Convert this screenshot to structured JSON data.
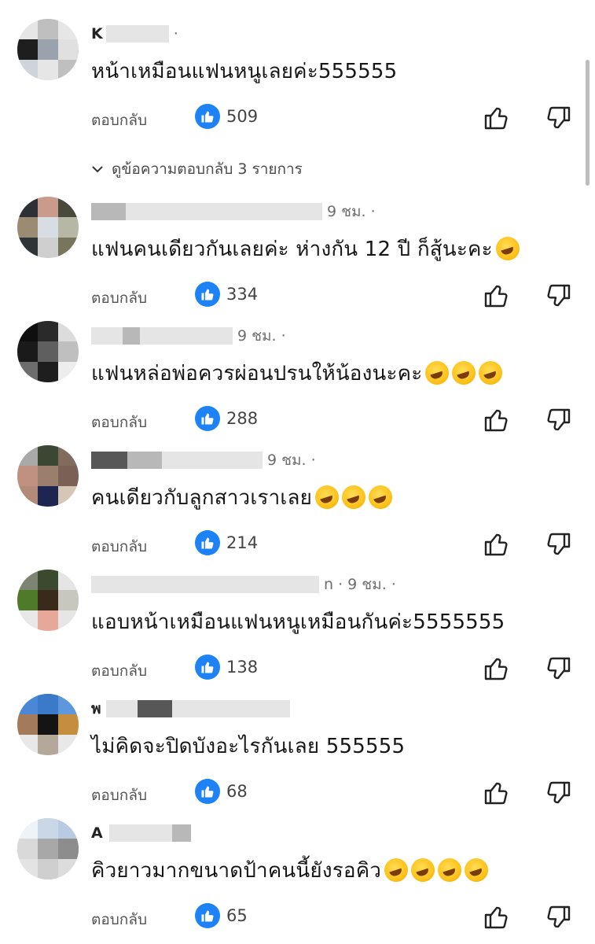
{
  "reply_label": "ตอบกลับ",
  "view_replies_label": "ดูข้อความตอบกลับ 3 รายการ",
  "colors": {
    "like_badge": "#1d82f5",
    "text": "#161616",
    "muted": "#6e6e6e"
  },
  "comments": [
    {
      "name": "K",
      "meta": "·",
      "text": "หน้าเหมือนแฟนหนูเลยค่ะ555555",
      "emoji_count": 0,
      "likes": "509",
      "avatar": [
        "#e6e6e6",
        "#bfbfbf",
        "#e6e6e6",
        "#1e1e1e",
        "#9aa2ad",
        "#e0e0e0",
        "#cfd4da",
        "#e6e6e6",
        "#bfbfbf"
      ]
    },
    {
      "name": "",
      "meta": "9 ชม. ·",
      "text": "แฟนคนเดียวกันเลยค่ะ ห่างกัน 12 ปี ก็สู้นะคะ",
      "emoji_count": 1,
      "likes": "334",
      "avatar": [
        "#2d3136",
        "#c99b8c",
        "#4a4a3c",
        "#9b8b72",
        "#d7dde2",
        "#b7b7a6",
        "#2f3436",
        "#cfcfcf",
        "#77755c"
      ]
    },
    {
      "name": "",
      "meta": "9 ชม. ·",
      "text": "แฟนหล่อพ่อควรผ่อนปรนให้น้องนะคะ",
      "emoji_count": 3,
      "likes": "288",
      "avatar": [
        "#0f0f0f",
        "#2a2a2a",
        "#dcdcdc",
        "#1a1a1a",
        "#5f5f5f",
        "#bfbfbf",
        "#6d6d6d",
        "#1e1e1e",
        "#ededed"
      ]
    },
    {
      "name": "",
      "meta": "9 ชม. ·",
      "text": "คนเดียวกับลูกสาวเราเลย",
      "emoji_count": 3,
      "likes": "214",
      "avatar": [
        "#a9a9a9",
        "#3b4733",
        "#806b5d",
        "#c09080",
        "#9a7f6c",
        "#7a6055",
        "#b18a7a",
        "#1d2550",
        "#d4c7b6"
      ]
    },
    {
      "name": "",
      "meta": "n · 9 ชม. ·",
      "text": "แอบหน้าเหมือนแฟนหนูเหมือนกันค่ะ5555555",
      "emoji_count": 0,
      "likes": "138",
      "avatar": [
        "#7d8471",
        "#3b4a2e",
        "#e5e5e5",
        "#4e7a2a",
        "#3a2a1c",
        "#c7c7bd",
        "#e8e8e8",
        "#e6a898",
        "#e6e6e6"
      ]
    },
    {
      "name": "พ",
      "meta": "",
      "text": "ไม่คิดจะปิดบังอะไรกันเลย 555555",
      "emoji_count": 0,
      "likes": "68",
      "avatar": [
        "#4a87d6",
        "#3b7ac9",
        "#5d97dd",
        "#a47b5a",
        "#141414",
        "#c58d3e",
        "#e8e8e8",
        "#b4a89b",
        "#e8e8e8"
      ]
    },
    {
      "name": "A",
      "meta": "",
      "text": "คิวยาวมากขนาดป้าคนนี้ยังรอคิว",
      "emoji_count": 4,
      "likes": "65",
      "avatar": [
        "#eef3f8",
        "#c9d7e6",
        "#b9cbe0",
        "#d9d9d9",
        "#a8a8a8",
        "#8d8d8d",
        "#e3e3e3",
        "#cfcfcf",
        "#dcdcdc"
      ]
    }
  ]
}
